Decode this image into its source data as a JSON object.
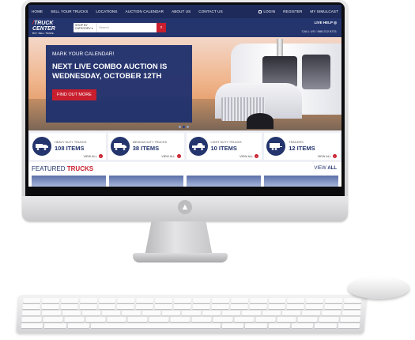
{
  "topbar": {
    "nav": [
      "HOME",
      "SELL YOUR TRUCKS",
      "LOCATIONS",
      "AUCTION CALENDAR",
      "ABOUT US",
      "CONTACT US"
    ],
    "login": "LOGIN",
    "register": "REGISTER",
    "simulcast": "MY SIMULCAST"
  },
  "brand": {
    "line1": "TRUCK",
    "line2": "CENTER",
    "tagline": "BUY. SELL. TRADE."
  },
  "search": {
    "category_label": "SHOP BY CATEGORY",
    "placeholder": "Search"
  },
  "header": {
    "live_help": "LIVE HELP",
    "call_us": "CALL US / 888.212.8721"
  },
  "hero": {
    "subtitle": "MARK YOUR CALENDAR!",
    "headline": "NEXT LIVE COMBO AUCTION IS WEDNESDAY, OCTOBER 12TH",
    "cta": "FIND OUT MORE",
    "slide_count": 3,
    "active_slide": 2
  },
  "categories": [
    {
      "label": "HEAVY DUTY TRUCKS",
      "count": "108 ITEMS",
      "view_all": "VIEW ALL",
      "icon": "heavy-truck-icon"
    },
    {
      "label": "MEDIUM DUTY TRUCKS",
      "count": "38 ITEMS",
      "view_all": "VIEW ALL",
      "icon": "box-truck-icon"
    },
    {
      "label": "LIGHT DUTY TRUCKS",
      "count": "10 ITEMS",
      "view_all": "VIEW ALL",
      "icon": "light-truck-icon"
    },
    {
      "label": "TRAILERS",
      "count": "12 ITEMS",
      "view_all": "VIEW ALL",
      "icon": "trailer-icon"
    }
  ],
  "featured": {
    "title_a": "FEATURED",
    "title_b": "TRUCKS",
    "view_a": "VIEW",
    "view_b": "ALL"
  },
  "colors": {
    "navy": "#24356e",
    "red": "#c81e2d"
  }
}
